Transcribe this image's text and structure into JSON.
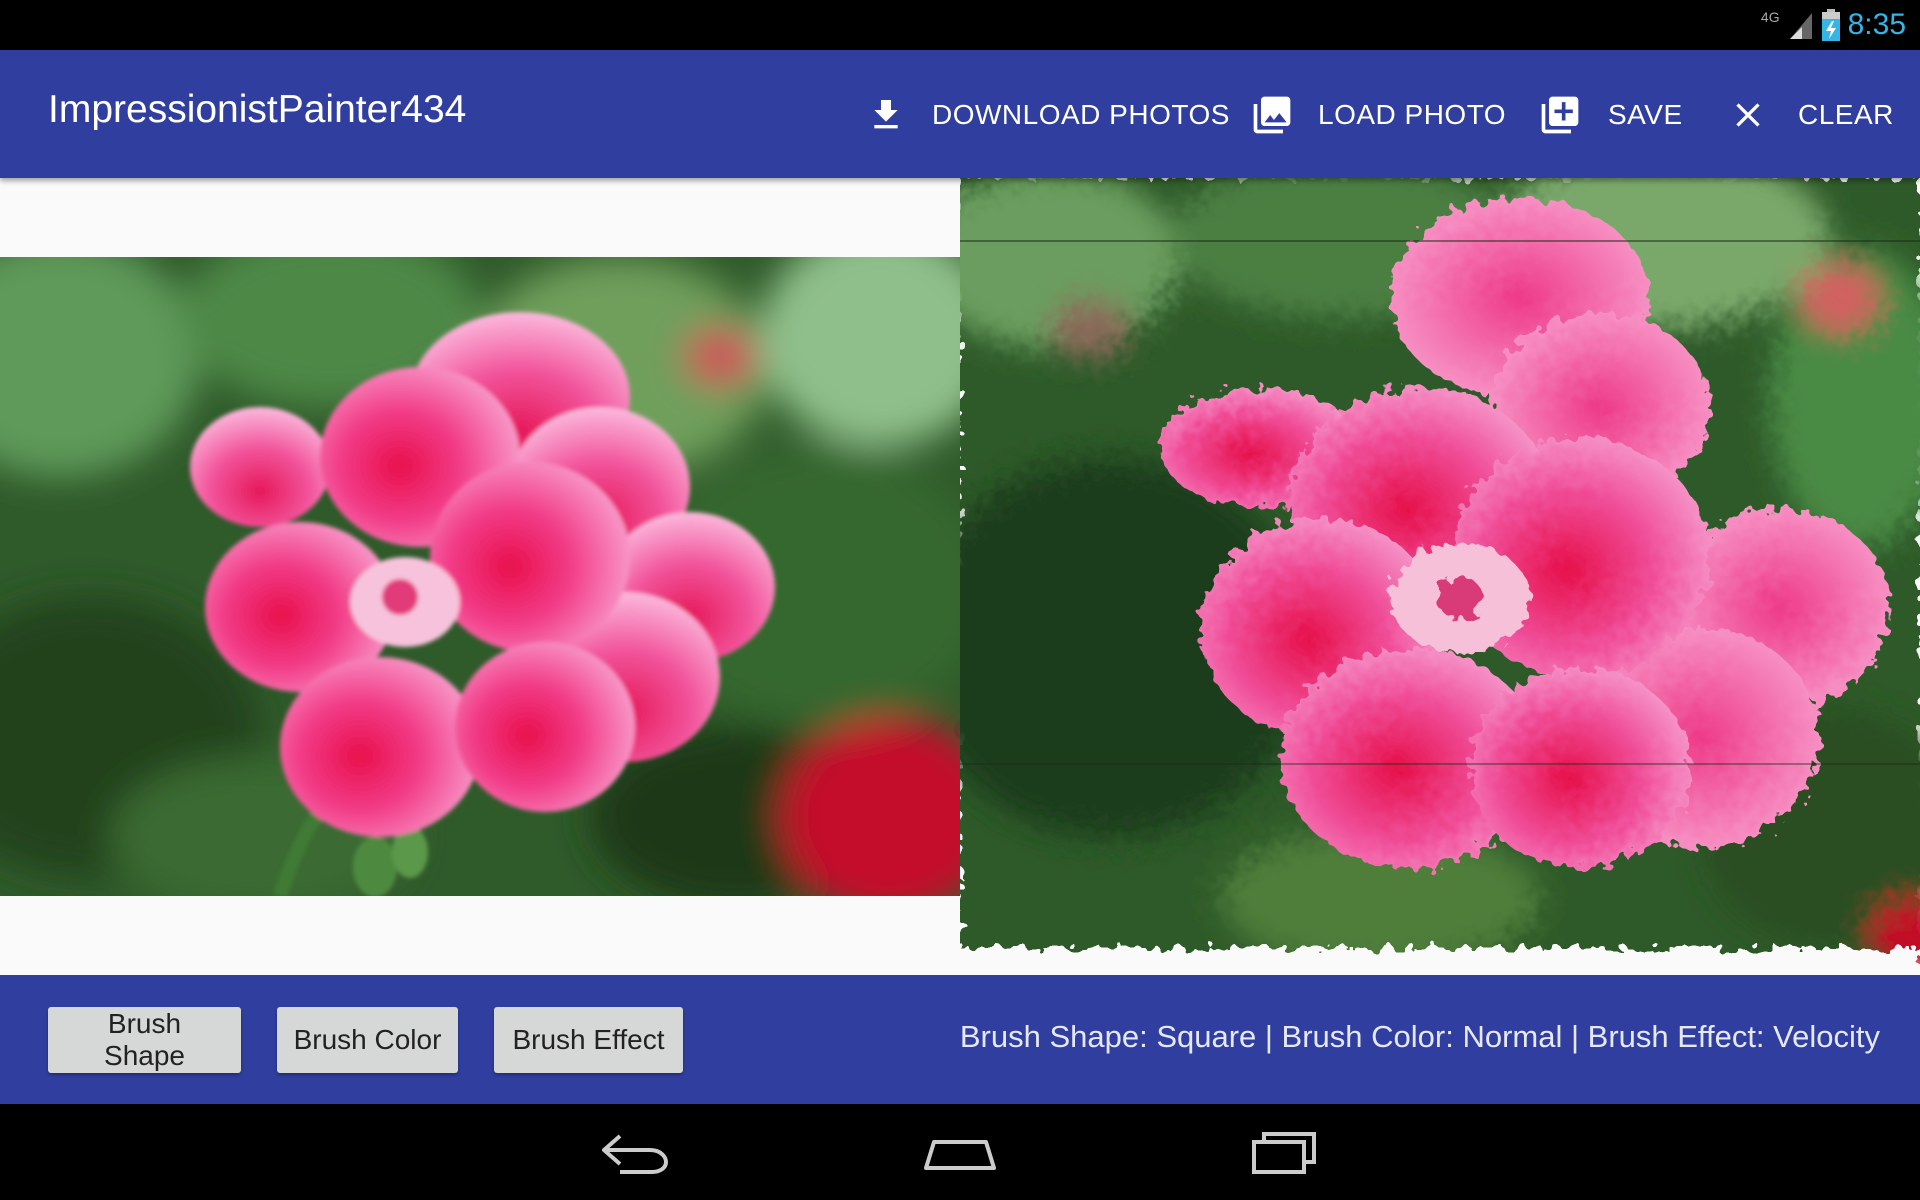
{
  "status_bar": {
    "network_type": "4G",
    "time": "8:35",
    "icons": [
      "signal-icon",
      "battery-charging-icon"
    ]
  },
  "app_bar": {
    "title": "ImpressionistPainter434",
    "actions": [
      {
        "label": "DOWNLOAD PHOTOS",
        "icon": "download-icon"
      },
      {
        "label": "LOAD PHOTO",
        "icon": "photo-library-icon"
      },
      {
        "label": "SAVE",
        "icon": "add-to-library-icon"
      },
      {
        "label": "CLEAR",
        "icon": "close-icon"
      }
    ]
  },
  "canvas": {
    "source_photo": "pink-geranium-photo",
    "painted_output": "impressionist-painting"
  },
  "bottom_bar": {
    "buttons": [
      "Brush Shape",
      "Brush Color",
      "Brush Effect"
    ],
    "status_text": "Brush Shape: Square | Brush Color: Normal | Brush Effect: Velocity"
  },
  "nav_bar": {
    "icons": [
      "back-icon",
      "home-icon",
      "recents-icon"
    ]
  },
  "colors": {
    "primary": "#303f9f",
    "status_clock": "#33b5e5",
    "button_bg": "#d6d7d7",
    "canvas_bg": "#fafafa"
  }
}
